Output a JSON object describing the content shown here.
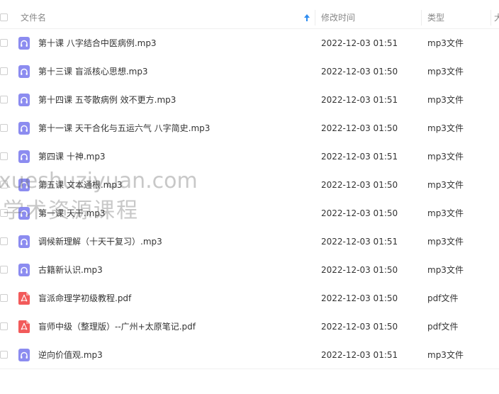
{
  "header": {
    "name_label": "文件名",
    "time_label": "修改时间",
    "type_label": "类型",
    "edge_label": "大"
  },
  "colors": {
    "audio_icon": "#8c8cf0",
    "pdf_icon": "#f25a5a",
    "sort_arrow": "#2e8cf0"
  },
  "files": [
    {
      "name": "第十课 八字结合中医病例.mp3",
      "time": "2022-12-03 01:51",
      "type": "mp3文件",
      "icon": "audio-icon"
    },
    {
      "name": "第十三课 盲派核心思想.mp3",
      "time": "2022-12-03 01:50",
      "type": "mp3文件",
      "icon": "audio-icon"
    },
    {
      "name": "第十四课 五苓散病例 效不更方.mp3",
      "time": "2022-12-03 01:51",
      "type": "mp3文件",
      "icon": "audio-icon"
    },
    {
      "name": "第十一课 天干合化与五运六气 八字简史.mp3",
      "time": "2022-12-03 01:50",
      "type": "mp3文件",
      "icon": "audio-icon"
    },
    {
      "name": "第四课 十神.mp3",
      "time": "2022-12-03 01:51",
      "type": "mp3文件",
      "icon": "audio-icon"
    },
    {
      "name": "第五课 文本通根.mp3",
      "time": "2022-12-03 01:50",
      "type": "mp3文件",
      "icon": "audio-icon"
    },
    {
      "name": "第一课 天干.mp3",
      "time": "2022-12-03 01:50",
      "type": "mp3文件",
      "icon": "audio-icon"
    },
    {
      "name": "调候新理解（十天干复习）.mp3",
      "time": "2022-12-03 01:51",
      "type": "mp3文件",
      "icon": "audio-icon"
    },
    {
      "name": "古籍新认识.mp3",
      "time": "2022-12-03 01:50",
      "type": "mp3文件",
      "icon": "audio-icon"
    },
    {
      "name": "盲派命理学初级教程.pdf",
      "time": "2022-12-03 01:50",
      "type": "pdf文件",
      "icon": "pdf-icon"
    },
    {
      "name": "盲师中级（整理版）--广州+太原笔记.pdf",
      "time": "2022-12-03 01:50",
      "type": "pdf文件",
      "icon": "pdf-icon"
    },
    {
      "name": "逆向价值观.mp3",
      "time": "2022-12-03 01:51",
      "type": "mp3文件",
      "icon": "audio-icon"
    }
  ],
  "watermark": {
    "line1": "xueshuziyuan.com",
    "line2": "学术资源课程"
  }
}
